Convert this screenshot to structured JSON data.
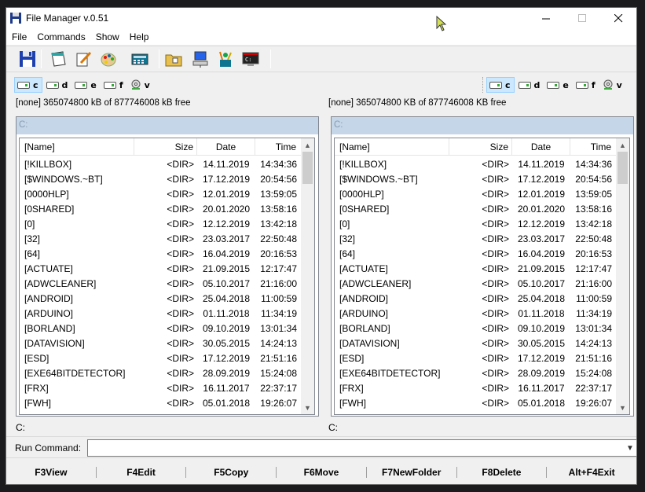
{
  "window": {
    "title": "File Manager v.0.51",
    "controls": {
      "minimize": "—",
      "maximize": "☐",
      "close": "✕"
    }
  },
  "menu": [
    "File",
    "Commands",
    "Show",
    "Help"
  ],
  "toolbar": [
    {
      "icon": "save-disk-icon"
    },
    {
      "sep": true
    },
    {
      "icon": "notes-icon"
    },
    {
      "icon": "notepad-pencil-icon"
    },
    {
      "icon": "paint-palette-icon"
    },
    {
      "icon": "calculator-icon"
    },
    {
      "sep": true
    },
    {
      "icon": "folder-search-icon"
    },
    {
      "icon": "network-computer-icon"
    },
    {
      "icon": "control-panel-icon"
    },
    {
      "icon": "command-prompt-icon"
    },
    {
      "sep": true
    }
  ],
  "drives": [
    "c",
    "d",
    "e",
    "f",
    "v"
  ],
  "left": {
    "info": "[none]  365074800 kB of 877746008 kB free",
    "path": "C:",
    "status": "C:",
    "active_drive": "c"
  },
  "right": {
    "info": "[none]  365074800 KB of 877746008 KB free",
    "path": "C:",
    "status": "C:",
    "active_drive": "c"
  },
  "columns": {
    "name": "[Name]",
    "size": "Size",
    "date": "Date",
    "time": "Time"
  },
  "files": [
    {
      "name": "[!KILLBOX]",
      "size": "<DIR>",
      "date": "14.11.2019",
      "time": "14:34:36"
    },
    {
      "name": "[$WINDOWS.~BT]",
      "size": "<DIR>",
      "date": "17.12.2019",
      "time": "20:54:56"
    },
    {
      "name": "[0000HLP]",
      "size": "<DIR>",
      "date": "12.01.2019",
      "time": "13:59:05"
    },
    {
      "name": "[0SHARED]",
      "size": "<DIR>",
      "date": "20.01.2020",
      "time": "13:58:16"
    },
    {
      "name": "[0]",
      "size": "<DIR>",
      "date": "12.12.2019",
      "time": "13:42:18"
    },
    {
      "name": "[32]",
      "size": "<DIR>",
      "date": "23.03.2017",
      "time": "22:50:48"
    },
    {
      "name": "[64]",
      "size": "<DIR>",
      "date": "16.04.2019",
      "time": "20:16:53"
    },
    {
      "name": "[ACTUATE]",
      "size": "<DIR>",
      "date": "21.09.2015",
      "time": "12:17:47"
    },
    {
      "name": "[ADWCLEANER]",
      "size": "<DIR>",
      "date": "05.10.2017",
      "time": "21:16:00"
    },
    {
      "name": "[ANDROID]",
      "size": "<DIR>",
      "date": "25.04.2018",
      "time": "11:00:59"
    },
    {
      "name": "[ARDUINO]",
      "size": "<DIR>",
      "date": "01.11.2018",
      "time": "11:34:19"
    },
    {
      "name": "[BORLAND]",
      "size": "<DIR>",
      "date": "09.10.2019",
      "time": "13:01:34"
    },
    {
      "name": "[DATAVISION]",
      "size": "<DIR>",
      "date": "30.05.2015",
      "time": "14:24:13"
    },
    {
      "name": "[ESD]",
      "size": "<DIR>",
      "date": "17.12.2019",
      "time": "21:51:16"
    },
    {
      "name": "[EXE64BITDETECTOR]",
      "size": "<DIR>",
      "date": "28.09.2019",
      "time": "15:24:08"
    },
    {
      "name": "[FRX]",
      "size": "<DIR>",
      "date": "16.11.2017",
      "time": "22:37:17"
    },
    {
      "name": "[FWH]",
      "size": "<DIR>",
      "date": "05.01.2018",
      "time": "19:26:07"
    }
  ],
  "run": {
    "label": "Run Command:",
    "value": ""
  },
  "fkeys": [
    {
      "key": "F3",
      "label": "View"
    },
    {
      "key": "F4",
      "label": "Edit"
    },
    {
      "key": "F5",
      "label": "Copy"
    },
    {
      "key": "F6",
      "label": "Move"
    },
    {
      "key": "F7",
      "label": "NewFolder"
    },
    {
      "key": "F8",
      "label": "Delete"
    },
    {
      "key": "Alt+F4",
      "label": "Exit"
    }
  ],
  "colors": {
    "accent": "#cce8ff",
    "path_bar": "#c4d6e8",
    "cursor": "#d4e157"
  }
}
